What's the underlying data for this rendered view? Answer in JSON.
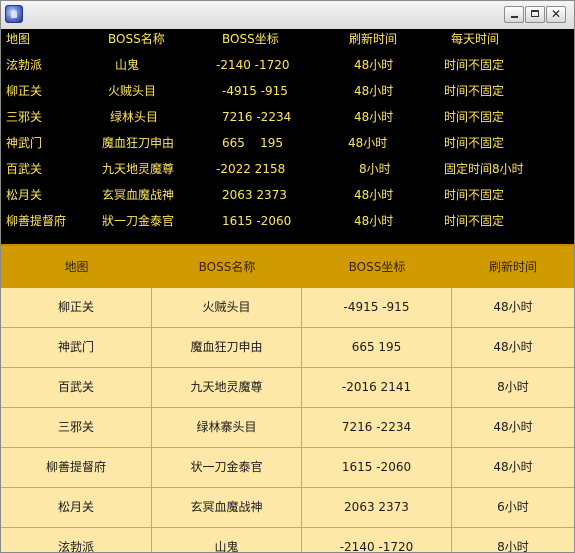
{
  "window": {
    "icon": "app-globe-icon",
    "controls": {
      "minimize": "minimize-icon",
      "maximize": "maximize-icon",
      "close": "✕"
    }
  },
  "top_list": {
    "headers": [
      "地图",
      "BOSS名称",
      "BOSS坐标",
      "刷新时间",
      "每天时间"
    ],
    "rows": [
      [
        "泫勃派",
        "山鬼",
        "-2140 -1720",
        "48小时",
        "时间不固定"
      ],
      [
        "柳正关",
        "火贼头目",
        "-4915 -915",
        "48小时",
        "时间不固定"
      ],
      [
        "三邪关",
        "绿林头目",
        "7216 -2234",
        "48小时",
        "时间不固定"
      ],
      [
        "神武门",
        "魔血狂刀申由",
        "665    195",
        "48小时",
        "时间不固定"
      ],
      [
        "百武关",
        "九天地灵魔尊",
        "-2022 2158",
        "8小时",
        "固定时间8小时"
      ],
      [
        "松月关",
        "玄冥血魔战神",
        "2063 2373",
        "48小时",
        "时间不固定"
      ],
      [
        "柳善提督府",
        "狀一刀金泰官",
        "1615 -2060",
        "48小时",
        "时间不固定"
      ]
    ]
  },
  "table": {
    "headers": [
      "地图",
      "BOSS名称",
      "BOSS坐标",
      "刷新时间"
    ],
    "rows": [
      [
        "柳正关",
        "火贼头目",
        "-4915 -915",
        "48小时"
      ],
      [
        "神武门",
        "魔血狂刀申由",
        "665 195",
        "48小时"
      ],
      [
        "百武关",
        "九天地灵魔尊",
        "-2016 2141",
        "8小时"
      ],
      [
        "三邪关",
        "绿林寨头目",
        "7216 -2234",
        "48小时"
      ],
      [
        "柳善提督府",
        "状一刀金泰官",
        "1615 -2060",
        "48小时"
      ],
      [
        "松月关",
        "玄冥血魔战神",
        "2063 2373",
        "6小时"
      ],
      [
        "泫勃派",
        "山鬼",
        "-2140 -1720",
        "8小时"
      ]
    ]
  },
  "colors": {
    "top_text": "#ffe55a",
    "header_bg": "#cf9b00",
    "row_bg": "#fde8a8"
  }
}
